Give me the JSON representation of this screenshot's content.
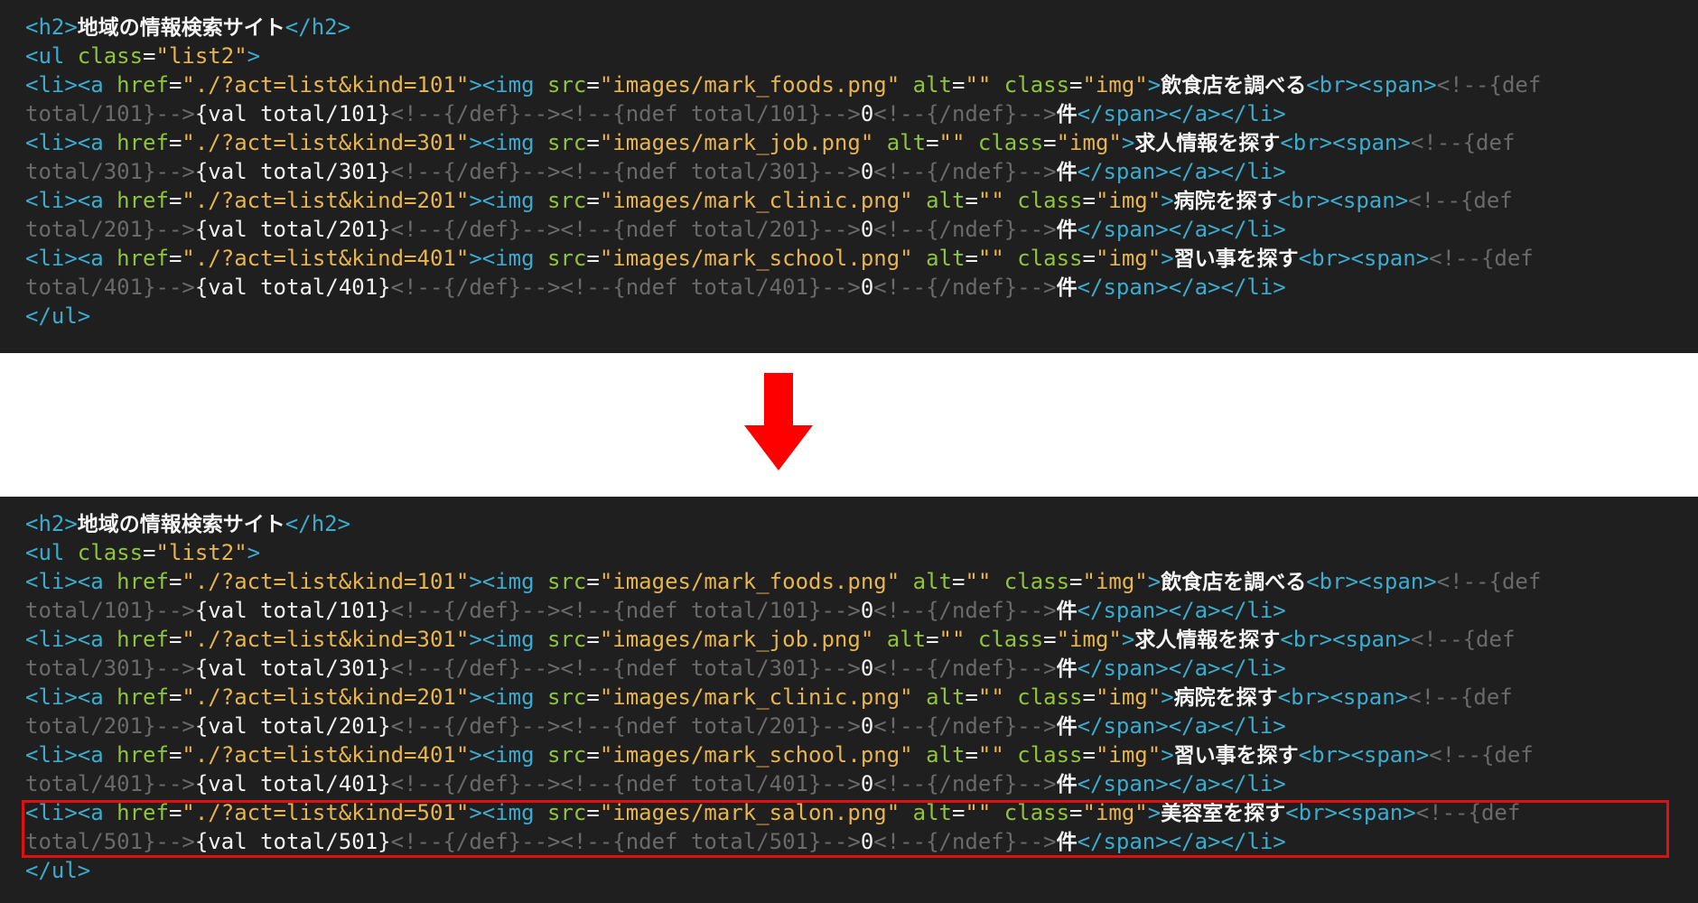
{
  "snippet_before": {
    "heading": "地域の情報検索サイト",
    "list_class": "list2",
    "items": [
      {
        "kind": "101",
        "img": "images/mark_foods.png",
        "label": "飲食店を調べる"
      },
      {
        "kind": "301",
        "img": "images/mark_job.png",
        "label": "求人情報を探す"
      },
      {
        "kind": "201",
        "img": "images/mark_clinic.png",
        "label": "病院を探す"
      },
      {
        "kind": "401",
        "img": "images/mark_school.png",
        "label": "習い事を探す"
      }
    ],
    "count_suffix": "件"
  },
  "snippet_after": {
    "heading": "地域の情報検索サイト",
    "list_class": "list2",
    "items": [
      {
        "kind": "101",
        "img": "images/mark_foods.png",
        "label": "飲食店を調べる"
      },
      {
        "kind": "301",
        "img": "images/mark_job.png",
        "label": "求人情報を探す"
      },
      {
        "kind": "201",
        "img": "images/mark_clinic.png",
        "label": "病院を探す"
      },
      {
        "kind": "401",
        "img": "images/mark_school.png",
        "label": "習い事を探す"
      },
      {
        "kind": "501",
        "img": "images/mark_salon.png",
        "label": "美容室を探す",
        "highlighted": true
      }
    ],
    "count_suffix": "件"
  },
  "colors": {
    "background": "#1f1f1f",
    "tag": "#3aaccf",
    "attribute": "#8fc53a",
    "string": "#e8b54d",
    "comment": "#6a6a6a",
    "arrow": "#ff0000",
    "highlight_border": "#e01010"
  },
  "arrow_icon": "arrow-down-icon"
}
